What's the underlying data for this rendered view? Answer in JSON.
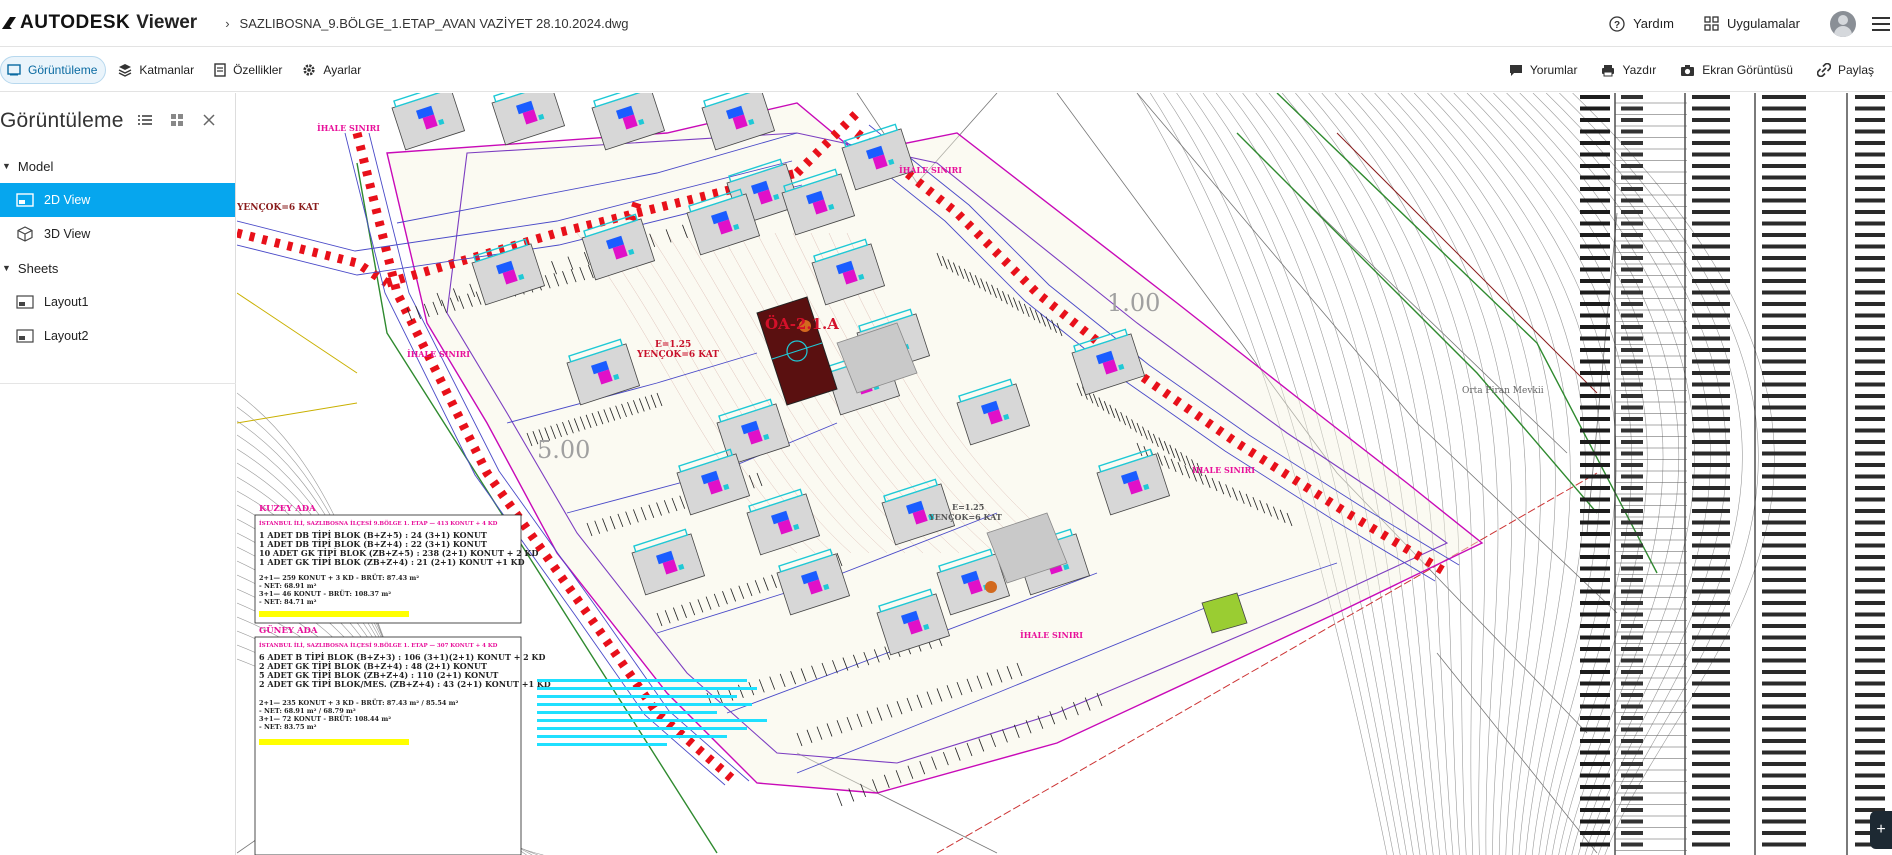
{
  "app": {
    "brand": "AUTODESK",
    "product": "Viewer",
    "file_name": "SAZLIBOSNA_9.BÖLGE_1.ETAP_AVAN VAZİYET 28.10.2024.dwg"
  },
  "header_right": {
    "help_label": "Yardım",
    "apps_label": "Uygulamalar"
  },
  "toolbar": {
    "left": [
      {
        "label": "Görüntüleme",
        "icon": "view-icon",
        "active": true
      },
      {
        "label": "Katmanlar",
        "icon": "layers-icon",
        "active": false
      },
      {
        "label": "Özellikler",
        "icon": "properties-icon",
        "active": false
      },
      {
        "label": "Ayarlar",
        "icon": "gear-icon",
        "active": false
      }
    ],
    "right": [
      {
        "label": "Yorumlar",
        "icon": "comment-icon"
      },
      {
        "label": "Yazdır",
        "icon": "print-icon"
      },
      {
        "label": "Ekran Görüntüsü",
        "icon": "camera-icon"
      },
      {
        "label": "Paylaş",
        "icon": "share-icon"
      }
    ]
  },
  "side_panel": {
    "title": "Görüntüleme",
    "model_label": "Model",
    "model_items": [
      {
        "label": "2D View",
        "icon": "2d-view-icon",
        "selected": true
      },
      {
        "label": "3D View",
        "icon": "cube-icon",
        "selected": false
      }
    ],
    "sheets_label": "Sheets",
    "sheet_items": [
      {
        "label": "Layout1",
        "icon": "layout-icon"
      },
      {
        "label": "Layout2",
        "icon": "layout-icon"
      }
    ]
  },
  "drawing": {
    "zone_title": "ÖA-2.1.A",
    "density_line1": "E=1.25",
    "density_line2": "YENÇOK=6 KAT",
    "density2_line1": "E=1.25",
    "density2_line2": "YENÇOK=6 KAT",
    "left_label": "YENÇOK=6 KAT",
    "ihale_label": "İHALE SINIRI",
    "kuzey_title": "KUZEY ADA",
    "kuzey_header": "İSTANBUL İLİ, SAZLIBOSNA İLÇESİ 9.BÖLGE 1. ETAP — 413 KONUT + 4 KD",
    "kuzey_lines": [
      "1 ADET DB TİPİ BLOK  (B+Z+5)  : 24 (3+1)  KONUT",
      "1 ADET DB TİPİ BLOK  (B+Z+4)  : 22 (3+1)  KONUT",
      "10 ADET GK TİPİ BLOK  (ZB+Z+5)  : 238 (2+1)  KONUT + 2 KD",
      "1 ADET GK TİPİ BLOK  (ZB+Z+4)  : 21 (2+1)  KONUT +1 KD"
    ],
    "kuzey_summary": [
      "2+1—  259 KONUT + 3 KD    - BRÜT: 87.43 m²",
      "                           - NET: 68.91 m²",
      "3+1—  46 KONUT            - BRÜT: 108.37 m²",
      "                           - NET: 84.71 m²"
    ],
    "guney_title": "GÜNEY ADA",
    "guney_header": "İSTANBUL İLİ, SAZLIBOSNA İLÇESİ 9.BÖLGE 1. ETAP — 307 KONUT + 4 KD",
    "guney_lines": [
      "6 ADET B TİPİ BLOK  (B+Z+3)  : 106 (3+1)(2+1) KONUT + 2 KD",
      "2 ADET GK TİPİ BLOK  (B+Z+4)  : 48 (2+1)  KONUT",
      "5 ADET GK TİPİ BLOK  (ZB+Z+4)  : 110 (2+1)  KONUT",
      "2 ADET GK TİPİ BLOK/MES.  (ZB+Z+4)  : 43 (2+1)  KONUT +1 KD"
    ],
    "guney_summary": [
      "2+1—  235 KONUT + 3 KD    - BRÜT: 87.43 m² / 85.54 m²",
      "                           - NET: 68.91 m² / 68.79 m²",
      "3+1—  72 KONUT            - BRÜT: 108.44 m²",
      "                           - NET: 83.75 m²"
    ],
    "locality_label": "Orta Piran Mevkii",
    "big_number_1": "5.00",
    "big_number_2": "1.00"
  },
  "colors": {
    "accent": "#06a6ee",
    "road_dash": "#e8101a",
    "boundary": "#e01ec0",
    "building_fill": "#d7d7d7"
  }
}
